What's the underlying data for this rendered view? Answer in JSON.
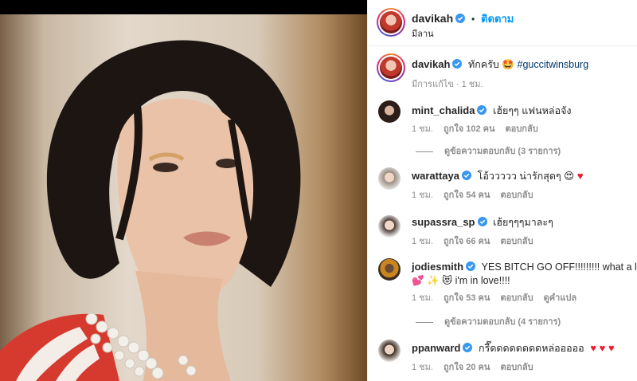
{
  "header": {
    "username": "davikah",
    "follow_label": "ติดตาม",
    "dot": "•",
    "location": "มีลาน"
  },
  "caption": {
    "username": "davikah",
    "text": "ทักครับ 🤩",
    "hashtag": "#guccitwinsburg",
    "meta": "มีการแก้ไข · 1 ชม."
  },
  "comments": [
    {
      "username": "mint_chalida",
      "text": "เฮ้ยๆๆ แฟนหล่อจัง",
      "time": "1 ชม.",
      "likes": "ถูกใจ 102 คน",
      "reply": "ตอบกลับ",
      "replies": "ดูข้อความตอบกลับ (3 รายการ)"
    },
    {
      "username": "warattaya",
      "text": "โอ้ววววว น่ารักสุดๆ 😍",
      "hearts": "♥",
      "time": "1 ชม.",
      "likes": "ถูกใจ 54 คน",
      "reply": "ตอบกลับ"
    },
    {
      "username": "supassra_sp",
      "text": "เฮ้ยๆๆๆมาละๆ",
      "time": "1 ชม.",
      "likes": "ถูกใจ 66 คน",
      "reply": "ตอบกลับ"
    },
    {
      "username": "jodiesmith",
      "text": "YES BITCH GO OFF!!!!!!!!! what a look!!!",
      "text2": "💕 ✨ 😻 i'm in love!!!!",
      "time": "1 ชม.",
      "likes": "ถูกใจ 53 คน",
      "reply": "ตอบกลับ",
      "translate": "ดูคำแปล",
      "replies": "ดูข้อความตอบกลับ (4 รายการ)"
    },
    {
      "username": "ppanward",
      "text": "กรี๊ดดดดดดดดหล่อออออ",
      "hearts": "♥ ♥ ♥",
      "time": "1 ชม.",
      "likes": "ถูกใจ 20 คน",
      "reply": "ตอบกลับ"
    }
  ],
  "colors": {
    "accent": "#0095f6",
    "verified": "#3897f0",
    "muted": "#8e8e8e",
    "heart": "#ed1c2e"
  }
}
